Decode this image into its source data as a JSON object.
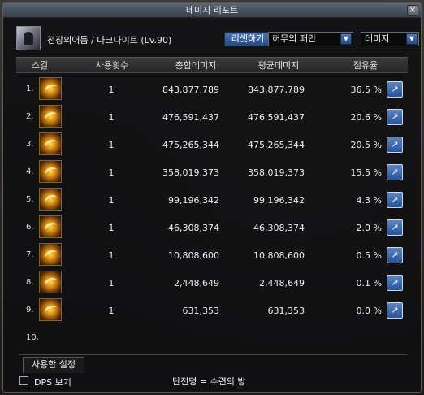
{
  "window": {
    "title": "데미지 리포트",
    "close_glyph": "×"
  },
  "header": {
    "character": "전장의어둠 / 다크나이트 (Lv.90)",
    "reset_label": "리셋하기",
    "dungeon_select": "허무의 패만",
    "type_select": "데미지"
  },
  "table": {
    "columns": [
      "스킬",
      "사용횟수",
      "총합데미지",
      "평균데미지",
      "점유율"
    ],
    "rows": [
      {
        "num": "1.",
        "count": "1",
        "total": "843,877,789",
        "avg": "843,877,789",
        "share": "36.5 %"
      },
      {
        "num": "2.",
        "count": "1",
        "total": "476,591,437",
        "avg": "476,591,437",
        "share": "20.6 %"
      },
      {
        "num": "3.",
        "count": "1",
        "total": "475,265,344",
        "avg": "475,265,344",
        "share": "20.5 %"
      },
      {
        "num": "4.",
        "count": "1",
        "total": "358,019,373",
        "avg": "358,019,373",
        "share": "15.5 %"
      },
      {
        "num": "5.",
        "count": "1",
        "total": "99,196,342",
        "avg": "99,196,342",
        "share": "4.3 %"
      },
      {
        "num": "6.",
        "count": "1",
        "total": "46,308,374",
        "avg": "46,308,374",
        "share": "2.0 %"
      },
      {
        "num": "7.",
        "count": "1",
        "total": "10,808,600",
        "avg": "10,808,600",
        "share": "0.5 %"
      },
      {
        "num": "8.",
        "count": "1",
        "total": "2,448,649",
        "avg": "2,448,649",
        "share": "0.1 %"
      },
      {
        "num": "9.",
        "count": "1",
        "total": "631,353",
        "avg": "631,353",
        "share": "0.0 %"
      }
    ],
    "empty_row": "10."
  },
  "footer": {
    "tab": "사용한 설정",
    "dps_label": "DPS 보기",
    "status": "단전명 = 수련의 방"
  },
  "colors": {
    "accent": "#2a5399",
    "title_bar": "#4a5260",
    "skill_icon": "#d58a12"
  },
  "icons": {
    "share": "share-icon",
    "dropdown": "chevron-down-icon",
    "skill": "skill-icon"
  }
}
